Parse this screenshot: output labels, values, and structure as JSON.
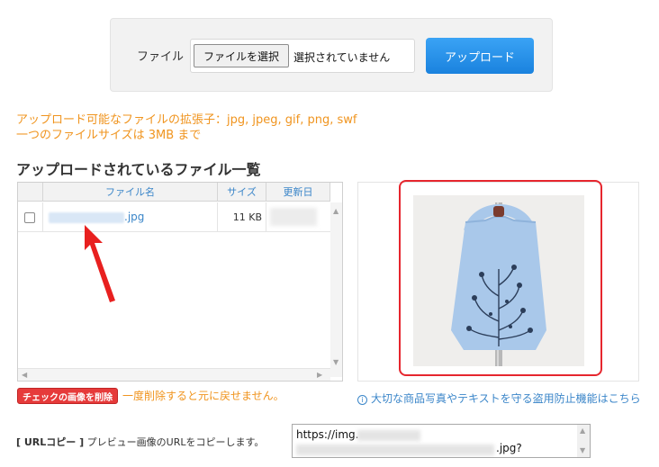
{
  "upload": {
    "file_label": "ファイル",
    "choose_button": "ファイルを選択",
    "no_file_text": "選択されていません",
    "upload_button": "アップロード"
  },
  "notes": {
    "extensions": "アップロード可能なファイルの拡張子：jpg, jpeg, gif, png, swf",
    "max_size": "一つのファイルサイズは 3MB まで"
  },
  "files_section": {
    "heading": "アップロードされているファイル一覧",
    "columns": [
      "ファイル名",
      "サイズ",
      "更新日"
    ],
    "rows": [
      {
        "name_suffix": ".jpg",
        "size": "11 KB",
        "checked": false
      }
    ]
  },
  "actions": {
    "delete_button": "チェックの画像を削除",
    "delete_note": "一度削除すると元に戻せません。",
    "protect_link": "大切な商品写真やテキストを守る盗用防止機能はこちら"
  },
  "url_copy": {
    "label_bracket": "[ URLコピー ]",
    "label_text": "プレビュー画像のURLをコピーします。",
    "value_start": "https://img.",
    "value_end": ".jpg?"
  },
  "icons": {
    "info": "info-icon",
    "pointer_arrow": "red-arrow-icon",
    "scroll_up": "triangle-up-icon",
    "scroll_down": "triangle-down-icon",
    "scroll_left": "triangle-left-icon",
    "scroll_right": "triangle-right-icon"
  },
  "colors": {
    "accent_blue": "#1a82de",
    "note_orange": "#f0941e",
    "link_blue": "#3b86c9",
    "delete_red": "#e63a3a",
    "highlight_red": "#e6262e",
    "bag_blue": "#a9c8ea"
  }
}
